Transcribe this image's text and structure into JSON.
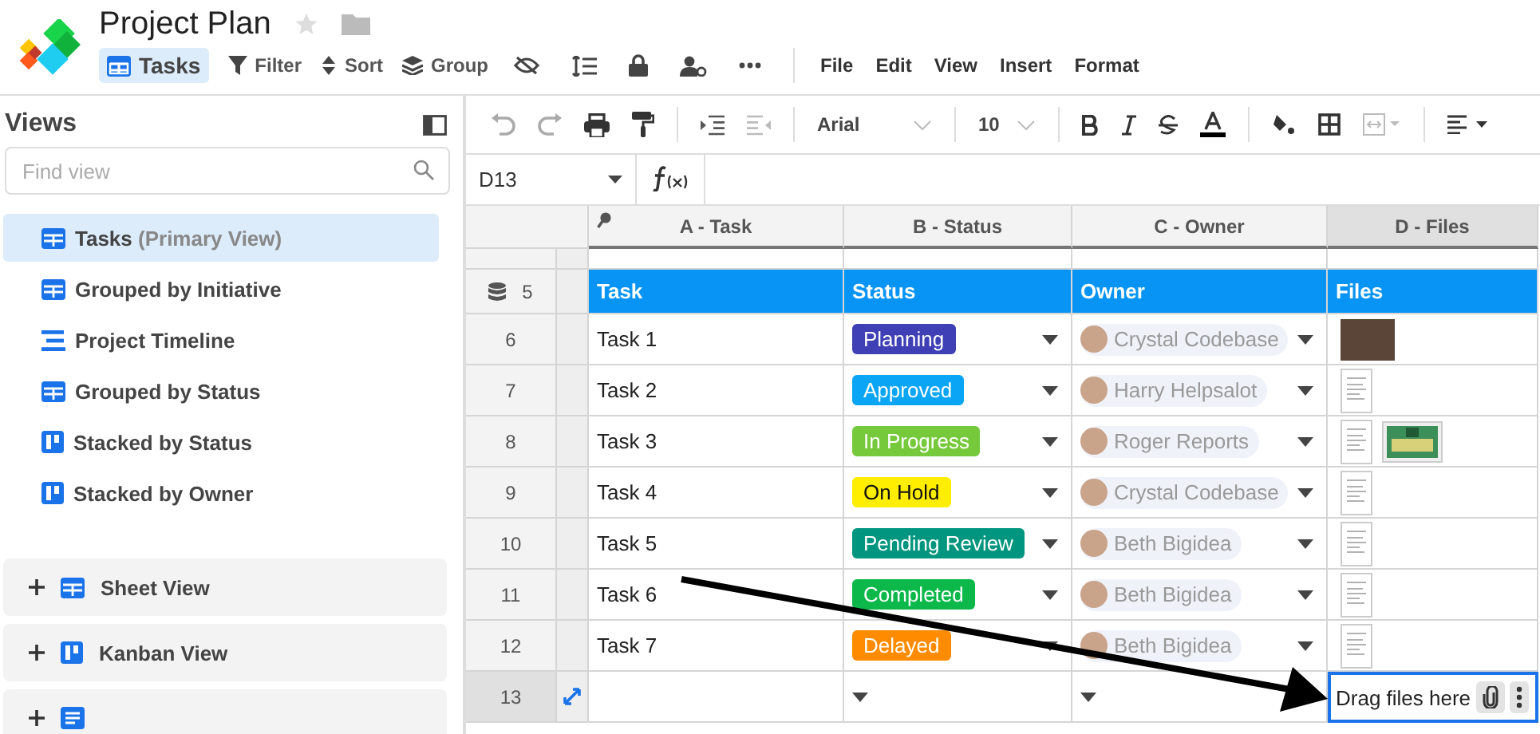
{
  "title": "Project Plan",
  "view_tabs": [
    {
      "label": "Tasks",
      "selected": true
    }
  ],
  "tools": [
    {
      "label": "Filter",
      "kind": "filter"
    },
    {
      "label": "Sort",
      "kind": "sort"
    },
    {
      "label": "Group",
      "kind": "group"
    }
  ],
  "menus": [
    "File",
    "Edit",
    "View",
    "Insert",
    "Format"
  ],
  "sidebar": {
    "heading": "Views",
    "search": {
      "placeholder": "Find view"
    },
    "views": [
      {
        "label": "Tasks",
        "note": "(Primary View)",
        "kind": "grid",
        "selected": true
      },
      {
        "label": "Grouped by Initiative",
        "kind": "grid",
        "selected": false
      },
      {
        "label": "Project Timeline",
        "kind": "timeline",
        "selected": false
      },
      {
        "label": "Grouped by Status",
        "kind": "grid",
        "selected": false
      },
      {
        "label": "Stacked by Status",
        "kind": "kanban",
        "selected": false
      },
      {
        "label": "Stacked by Owner",
        "kind": "kanban",
        "selected": false
      }
    ],
    "sections": [
      {
        "label": "Sheet View",
        "kind": "grid"
      },
      {
        "label": "Kanban View",
        "kind": "kanban"
      },
      {
        "kind": "form"
      }
    ]
  },
  "format_bar": {
    "font": "Arial",
    "size": "10"
  },
  "formula_bar": {
    "cell": "D13"
  },
  "grid": {
    "columns": [
      {
        "label": "A - Task",
        "primary": true,
        "selected": false
      },
      {
        "label": "B - Status",
        "primary": false,
        "selected": false
      },
      {
        "label": "C - Owner",
        "primary": false,
        "selected": false
      },
      {
        "label": "D - Files",
        "primary": false,
        "selected": true
      }
    ],
    "header_row": {
      "number": "5",
      "cells": [
        "Task",
        "Status",
        "Owner",
        "Files"
      ]
    },
    "rows": [
      {
        "number": "6",
        "task": "Task 1",
        "status": {
          "label": "Planning",
          "color": "#3f40b5"
        },
        "owner": "Crystal Codebase",
        "files": [
          {
            "kind": "photo"
          }
        ],
        "selected": false
      },
      {
        "number": "7",
        "task": "Task 2",
        "status": {
          "label": "Approved",
          "color": "#0ba5f5"
        },
        "owner": "Harry Helpsalot",
        "files": [
          {
            "kind": "document"
          }
        ],
        "selected": false
      },
      {
        "number": "8",
        "task": "Task 3",
        "status": {
          "label": "In Progress",
          "color": "#77c93c"
        },
        "owner": "Roger Reports",
        "files": [
          {
            "kind": "document"
          },
          {
            "kind": "certificate"
          }
        ],
        "selected": false
      },
      {
        "number": "9",
        "task": "Task 4",
        "status": {
          "label": "On Hold",
          "color": "#ffee00"
        },
        "owner": "Crystal Codebase",
        "files": [
          {
            "kind": "document"
          }
        ],
        "selected": false
      },
      {
        "number": "10",
        "task": "Task 5",
        "status": {
          "label": "Pending Review",
          "color": "#00957e"
        },
        "owner": "Beth Bigidea",
        "files": [
          {
            "kind": "document"
          }
        ],
        "selected": false
      },
      {
        "number": "11",
        "task": "Task 6",
        "status": {
          "label": "Completed",
          "color": "#0db84b"
        },
        "owner": "Beth Bigidea",
        "files": [
          {
            "kind": "document"
          }
        ],
        "selected": false
      },
      {
        "number": "12",
        "task": "Task 7",
        "status": {
          "label": "Delayed",
          "color": "#ff8c00"
        },
        "owner": "Beth Bigidea",
        "files": [
          {
            "kind": "document"
          }
        ],
        "selected": false
      },
      {
        "number": "13",
        "files_hint": "Drag files here",
        "files": [],
        "selected": true
      }
    ]
  }
}
